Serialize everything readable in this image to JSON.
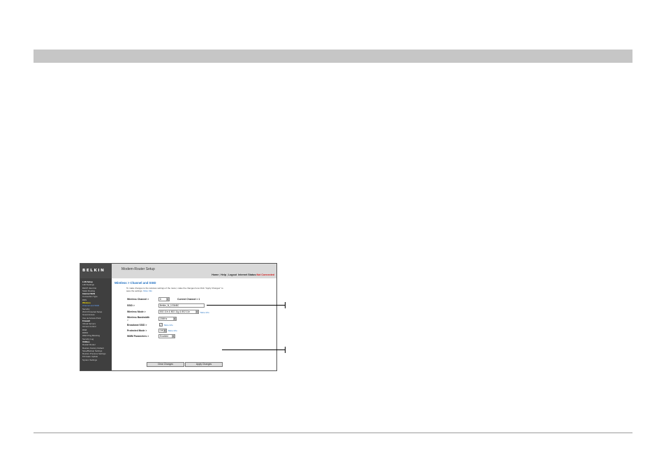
{
  "app": {
    "brand": "BELKIN",
    "title": "Modem-Router Setup"
  },
  "top_links": {
    "home": "Home",
    "help": "Help",
    "logout": "Logout",
    "internet_status_label": "Internet Status:",
    "internet_status_value": "Not Connected"
  },
  "sidebar": {
    "items": [
      {
        "label": "LAN Setup",
        "type": "head"
      },
      {
        "label": "LAN Settings",
        "type": "item"
      },
      {
        "label": "DHCP client list",
        "type": "item"
      },
      {
        "label": "Static Routing",
        "type": "item"
      },
      {
        "label": "Internet WAN",
        "type": "head"
      },
      {
        "label": "Connection Type",
        "type": "item"
      },
      {
        "label": "DNS",
        "type": "item"
      },
      {
        "label": "Wireless",
        "type": "active"
      },
      {
        "label": "Channel and SSID",
        "type": "sel"
      },
      {
        "label": "Security",
        "type": "item"
      },
      {
        "label": "Wi-Fi Protected Setup",
        "type": "item"
      },
      {
        "label": "Guest Access",
        "type": "item"
      },
      {
        "label": "Use as Access Point",
        "type": "item"
      },
      {
        "label": "Firewall",
        "type": "head"
      },
      {
        "label": "Virtual Servers",
        "type": "item"
      },
      {
        "label": "Access Control",
        "type": "item"
      },
      {
        "label": "DMZ",
        "type": "item"
      },
      {
        "label": "DDNS",
        "type": "item"
      },
      {
        "label": "WAN Ping Blocking",
        "type": "item"
      },
      {
        "label": "Security Log",
        "type": "item"
      },
      {
        "label": "Utilities",
        "type": "head"
      },
      {
        "label": "Restart Router",
        "type": "item"
      },
      {
        "label": "Restore Factory Default",
        "type": "item"
      },
      {
        "label": "Save/Backup Settings",
        "type": "item"
      },
      {
        "label": "Restore Previous Settings",
        "type": "item"
      },
      {
        "label": "Firmware Update",
        "type": "item"
      },
      {
        "label": "System Settings",
        "type": "item"
      }
    ]
  },
  "main": {
    "breadcrumb": "Wireless > Channel and SSID",
    "intro": "To make changes to the wireless settings of the router, make the changes here.Click \"Apply Changes\" to save the settings.",
    "intro_more": "More Info",
    "fields": {
      "wireless_channel_label": "Wireless Channel >",
      "wireless_channel_value": "6",
      "current_channel_label": "Current Channel > 1",
      "ssid_label": "SSID >",
      "ssid_value": "Belkin_N_123ABC",
      "wireless_mode_label": "Wireless Mode >",
      "wireless_mode_value": "802.11b & 802.11g & 802.11n",
      "wireless_mode_more": "More Info",
      "bandwidth_label": "Wireless Bandwidth",
      "bandwidth_label2": ">",
      "bandwidth_value": "20MHz",
      "broadcast_label": "Broadcast SSID >",
      "broadcast_more": "More Info",
      "protected_label": "Protected Mode >",
      "protected_value": "Off",
      "protected_more": "More Info",
      "wmm_label": "WMM Parameters >",
      "wmm_value": "Enabled"
    },
    "buttons": {
      "clear": "Clear Changes",
      "apply": "Apply Changes"
    }
  }
}
